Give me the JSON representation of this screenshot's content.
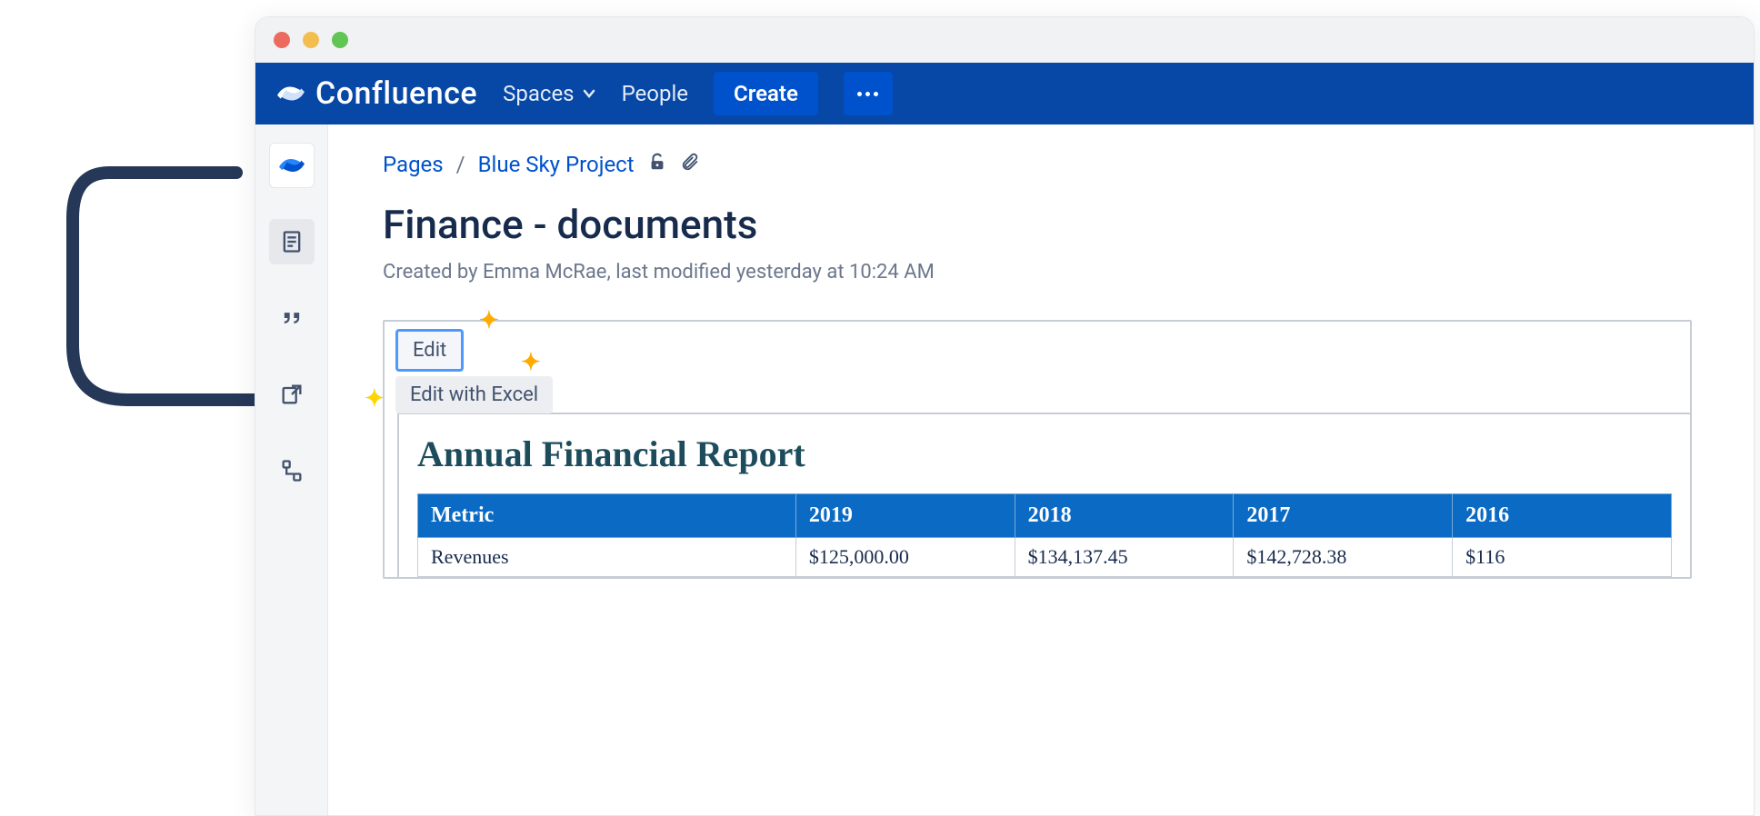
{
  "topbar": {
    "brand": "Confluence",
    "spaces": "Spaces",
    "people": "People",
    "create": "Create"
  },
  "breadcrumbs": {
    "pages": "Pages",
    "project": "Blue Sky Project"
  },
  "page": {
    "title": "Finance - documents",
    "meta": "Created by Emma McRae, last modified yesterday at 10:24 AM"
  },
  "chips": {
    "edit": "Edit",
    "edit_excel": "Edit with Excel"
  },
  "report": {
    "title": "Annual Financial Report",
    "headers": [
      "Metric",
      "2019",
      "2018",
      "2017",
      "2016"
    ],
    "rows": [
      {
        "metric": "Revenues",
        "y2019": "$125,000.00",
        "y2018": "$134,137.45",
        "y2017": "$142,728.38",
        "y2016": "$116"
      }
    ]
  }
}
